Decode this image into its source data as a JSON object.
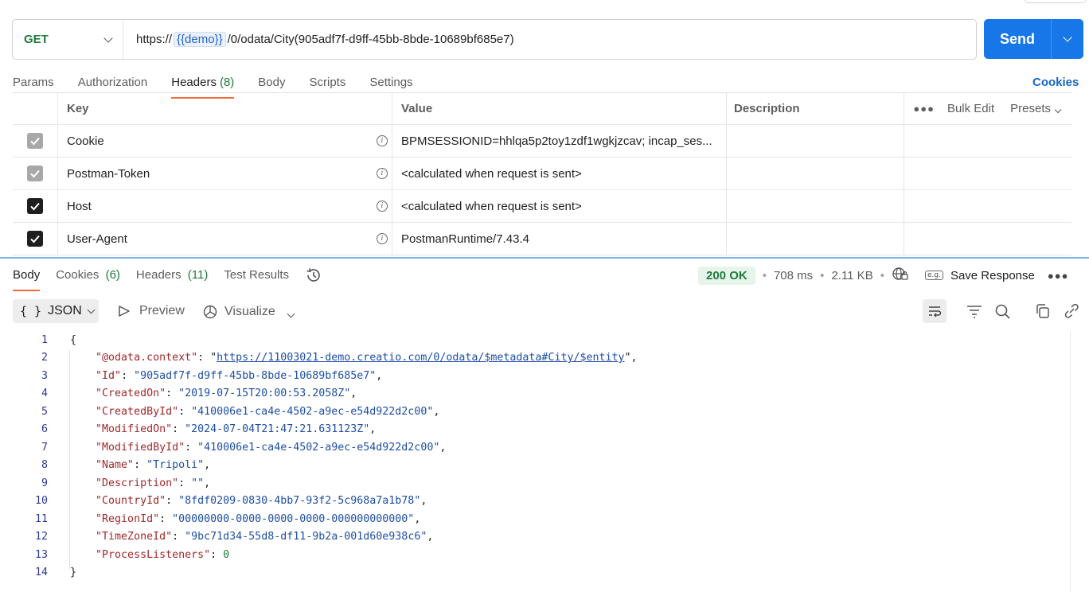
{
  "request": {
    "method": "GET",
    "url_prefix": "https://",
    "url_variable": "{{demo}}",
    "url_suffix": "/0/odata/City(905adf7f-d9ff-45bb-8bde-10689bf685e7)",
    "send_label": "Send"
  },
  "request_tabs": [
    {
      "label": "Params"
    },
    {
      "label": "Authorization"
    },
    {
      "label": "Headers",
      "count": "(8)"
    },
    {
      "label": "Body"
    },
    {
      "label": "Scripts"
    },
    {
      "label": "Settings"
    }
  ],
  "cookies_link": "Cookies",
  "headers_table": {
    "columns": {
      "key": "Key",
      "value": "Value",
      "description": "Description"
    },
    "bulk_edit": "Bulk Edit",
    "presets": "Presets",
    "rows": [
      {
        "key": "Cookie",
        "value": "BPMSESSIONID=hhlqa5p2toy1zdf1wgkjzcav; incap_ses...",
        "checked_style": "grey"
      },
      {
        "key": "Postman-Token",
        "value": "<calculated when request is sent>",
        "checked_style": "grey"
      },
      {
        "key": "Host",
        "value": "<calculated when request is sent>",
        "checked_style": "dark"
      },
      {
        "key": "User-Agent",
        "value": "PostmanRuntime/7.43.4",
        "checked_style": "dark"
      }
    ]
  },
  "response_tabs": [
    {
      "label": "Body"
    },
    {
      "label": "Cookies",
      "count": "(6)"
    },
    {
      "label": "Headers",
      "count": "(11)"
    },
    {
      "label": "Test Results"
    }
  ],
  "response_status": {
    "status": "200 OK",
    "time": "708 ms",
    "size": "2.11 KB",
    "save_response": "Save Response",
    "eg_label": "e.g."
  },
  "response_toolbar": {
    "format": "JSON",
    "preview": "Preview",
    "visualize": "Visualize"
  },
  "code_lines": [
    {
      "n": "1",
      "parts": [
        {
          "t": "{",
          "c": "p"
        }
      ]
    },
    {
      "n": "2",
      "parts": [
        {
          "t": "    ",
          "c": "p"
        },
        {
          "t": "\"@odata.context\"",
          "c": "k"
        },
        {
          "t": ": \"",
          "c": "p"
        },
        {
          "t": "https://11003021-demo.creatio.com/0/odata/$metadata#City/$entity",
          "c": "u"
        },
        {
          "t": "\",",
          "c": "p"
        }
      ]
    },
    {
      "n": "3",
      "parts": [
        {
          "t": "    ",
          "c": "p"
        },
        {
          "t": "\"Id\"",
          "c": "k"
        },
        {
          "t": ": ",
          "c": "p"
        },
        {
          "t": "\"905adf7f-d9ff-45bb-8bde-10689bf685e7\"",
          "c": "s"
        },
        {
          "t": ",",
          "c": "p"
        }
      ]
    },
    {
      "n": "4",
      "parts": [
        {
          "t": "    ",
          "c": "p"
        },
        {
          "t": "\"CreatedOn\"",
          "c": "k"
        },
        {
          "t": ": ",
          "c": "p"
        },
        {
          "t": "\"2019-07-15T20:00:53.2058Z\"",
          "c": "s"
        },
        {
          "t": ",",
          "c": "p"
        }
      ]
    },
    {
      "n": "5",
      "parts": [
        {
          "t": "    ",
          "c": "p"
        },
        {
          "t": "\"CreatedById\"",
          "c": "k"
        },
        {
          "t": ": ",
          "c": "p"
        },
        {
          "t": "\"410006e1-ca4e-4502-a9ec-e54d922d2c00\"",
          "c": "s"
        },
        {
          "t": ",",
          "c": "p"
        }
      ]
    },
    {
      "n": "6",
      "parts": [
        {
          "t": "    ",
          "c": "p"
        },
        {
          "t": "\"ModifiedOn\"",
          "c": "k"
        },
        {
          "t": ": ",
          "c": "p"
        },
        {
          "t": "\"2024-07-04T21:47:21.631123Z\"",
          "c": "s"
        },
        {
          "t": ",",
          "c": "p"
        }
      ]
    },
    {
      "n": "7",
      "parts": [
        {
          "t": "    ",
          "c": "p"
        },
        {
          "t": "\"ModifiedById\"",
          "c": "k"
        },
        {
          "t": ": ",
          "c": "p"
        },
        {
          "t": "\"410006e1-ca4e-4502-a9ec-e54d922d2c00\"",
          "c": "s"
        },
        {
          "t": ",",
          "c": "p"
        }
      ]
    },
    {
      "n": "8",
      "parts": [
        {
          "t": "    ",
          "c": "p"
        },
        {
          "t": "\"Name\"",
          "c": "k"
        },
        {
          "t": ": ",
          "c": "p"
        },
        {
          "t": "\"Tripoli\"",
          "c": "s"
        },
        {
          "t": ",",
          "c": "p"
        }
      ]
    },
    {
      "n": "9",
      "parts": [
        {
          "t": "    ",
          "c": "p"
        },
        {
          "t": "\"Description\"",
          "c": "k"
        },
        {
          "t": ": ",
          "c": "p"
        },
        {
          "t": "\"\"",
          "c": "s"
        },
        {
          "t": ",",
          "c": "p"
        }
      ]
    },
    {
      "n": "10",
      "parts": [
        {
          "t": "    ",
          "c": "p"
        },
        {
          "t": "\"CountryId\"",
          "c": "k"
        },
        {
          "t": ": ",
          "c": "p"
        },
        {
          "t": "\"8fdf0209-0830-4bb7-93f2-5c968a7a1b78\"",
          "c": "s"
        },
        {
          "t": ",",
          "c": "p"
        }
      ]
    },
    {
      "n": "11",
      "parts": [
        {
          "t": "    ",
          "c": "p"
        },
        {
          "t": "\"RegionId\"",
          "c": "k"
        },
        {
          "t": ": ",
          "c": "p"
        },
        {
          "t": "\"00000000-0000-0000-0000-000000000000\"",
          "c": "s"
        },
        {
          "t": ",",
          "c": "p"
        }
      ]
    },
    {
      "n": "12",
      "parts": [
        {
          "t": "    ",
          "c": "p"
        },
        {
          "t": "\"TimeZoneId\"",
          "c": "k"
        },
        {
          "t": ": ",
          "c": "p"
        },
        {
          "t": "\"9bc71d34-55d8-df11-9b2a-001d60e938c6\"",
          "c": "s"
        },
        {
          "t": ",",
          "c": "p"
        }
      ]
    },
    {
      "n": "13",
      "parts": [
        {
          "t": "    ",
          "c": "p"
        },
        {
          "t": "\"ProcessListeners\"",
          "c": "k"
        },
        {
          "t": ": ",
          "c": "p"
        },
        {
          "t": "0",
          "c": "n"
        }
      ]
    },
    {
      "n": "14",
      "parts": [
        {
          "t": "}",
          "c": "p"
        }
      ]
    }
  ],
  "colors": {
    "accent": "#1777e8",
    "tab_underline": "#f26b3a",
    "method_get": "#1f7a3d",
    "json_key": "#a1282b",
    "json_string": "#1d4ea6"
  }
}
